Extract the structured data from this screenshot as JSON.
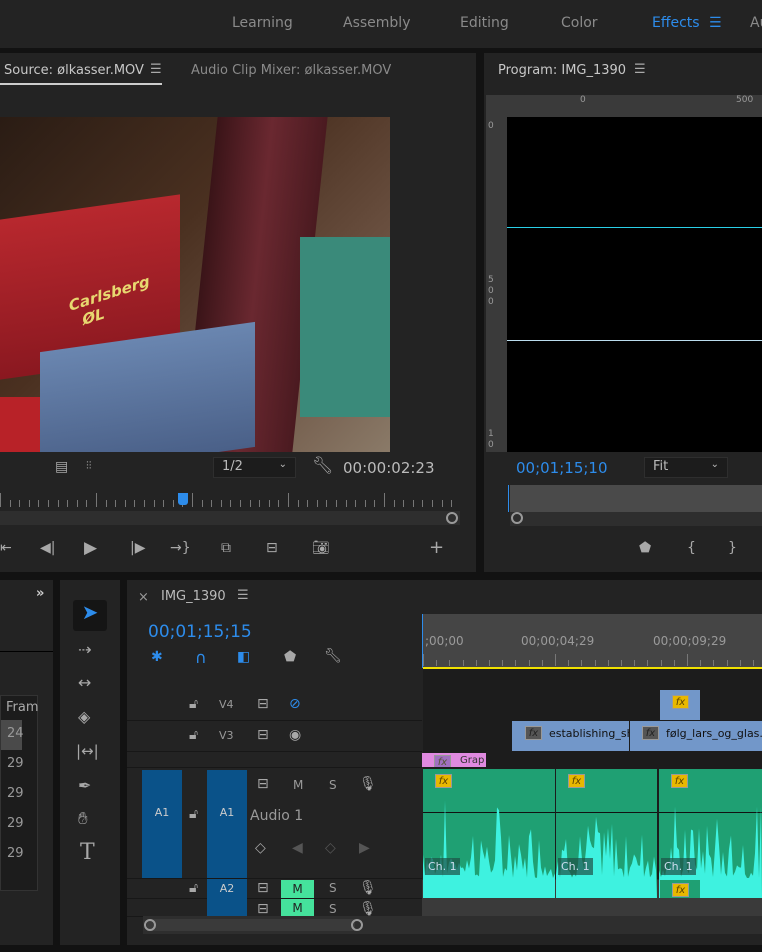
{
  "workspaces": {
    "items": [
      "Learning",
      "Assembly",
      "Editing",
      "Color",
      "Effects",
      "Au"
    ],
    "active": "Effects"
  },
  "source": {
    "tab": "Source: ølkasser.MOV",
    "tab2": "Audio Clip Mixer: ølkasser.MOV",
    "resolution": "1/2",
    "timecode": "00:00:02:23",
    "logo_text": "Carlsberg ØL"
  },
  "program": {
    "tab": "Program: IMG_1390",
    "timecode": "00;01;15;10",
    "zoom": "Fit",
    "ruler_top": [
      "0",
      "500"
    ],
    "ruler_left": [
      "0",
      "500",
      "10"
    ]
  },
  "project": {
    "col_header": "Fram",
    "rows": [
      "24",
      "29",
      "29",
      "29",
      "29"
    ]
  },
  "timeline": {
    "title": "IMG_1390",
    "close": "×",
    "timecode": "00;01;15;15",
    "ruler": [
      ";00;00",
      "00;00;04;29",
      "00;00;09;29"
    ],
    "tracks": {
      "v4": "V4",
      "v3": "V3",
      "a1_src": "A1",
      "a1": "A1",
      "a1_name": "Audio 1",
      "a2": "A2",
      "mute": "M",
      "solo": "S"
    },
    "clips": {
      "v3a": "establishing_sh",
      "v3b": "følg_lars_og_glas.M",
      "v2": "Grap",
      "fx": "fx",
      "ch": "Ch. 1"
    }
  },
  "colors": {
    "accent": "#2d8ceb",
    "audio_clip": "#1fa073",
    "waveform": "#3ef2e0",
    "video_clip": "#7297c9",
    "graphic_clip": "#e08ae0",
    "mute_on": "#45e29c",
    "track_target": "#0a5289"
  }
}
